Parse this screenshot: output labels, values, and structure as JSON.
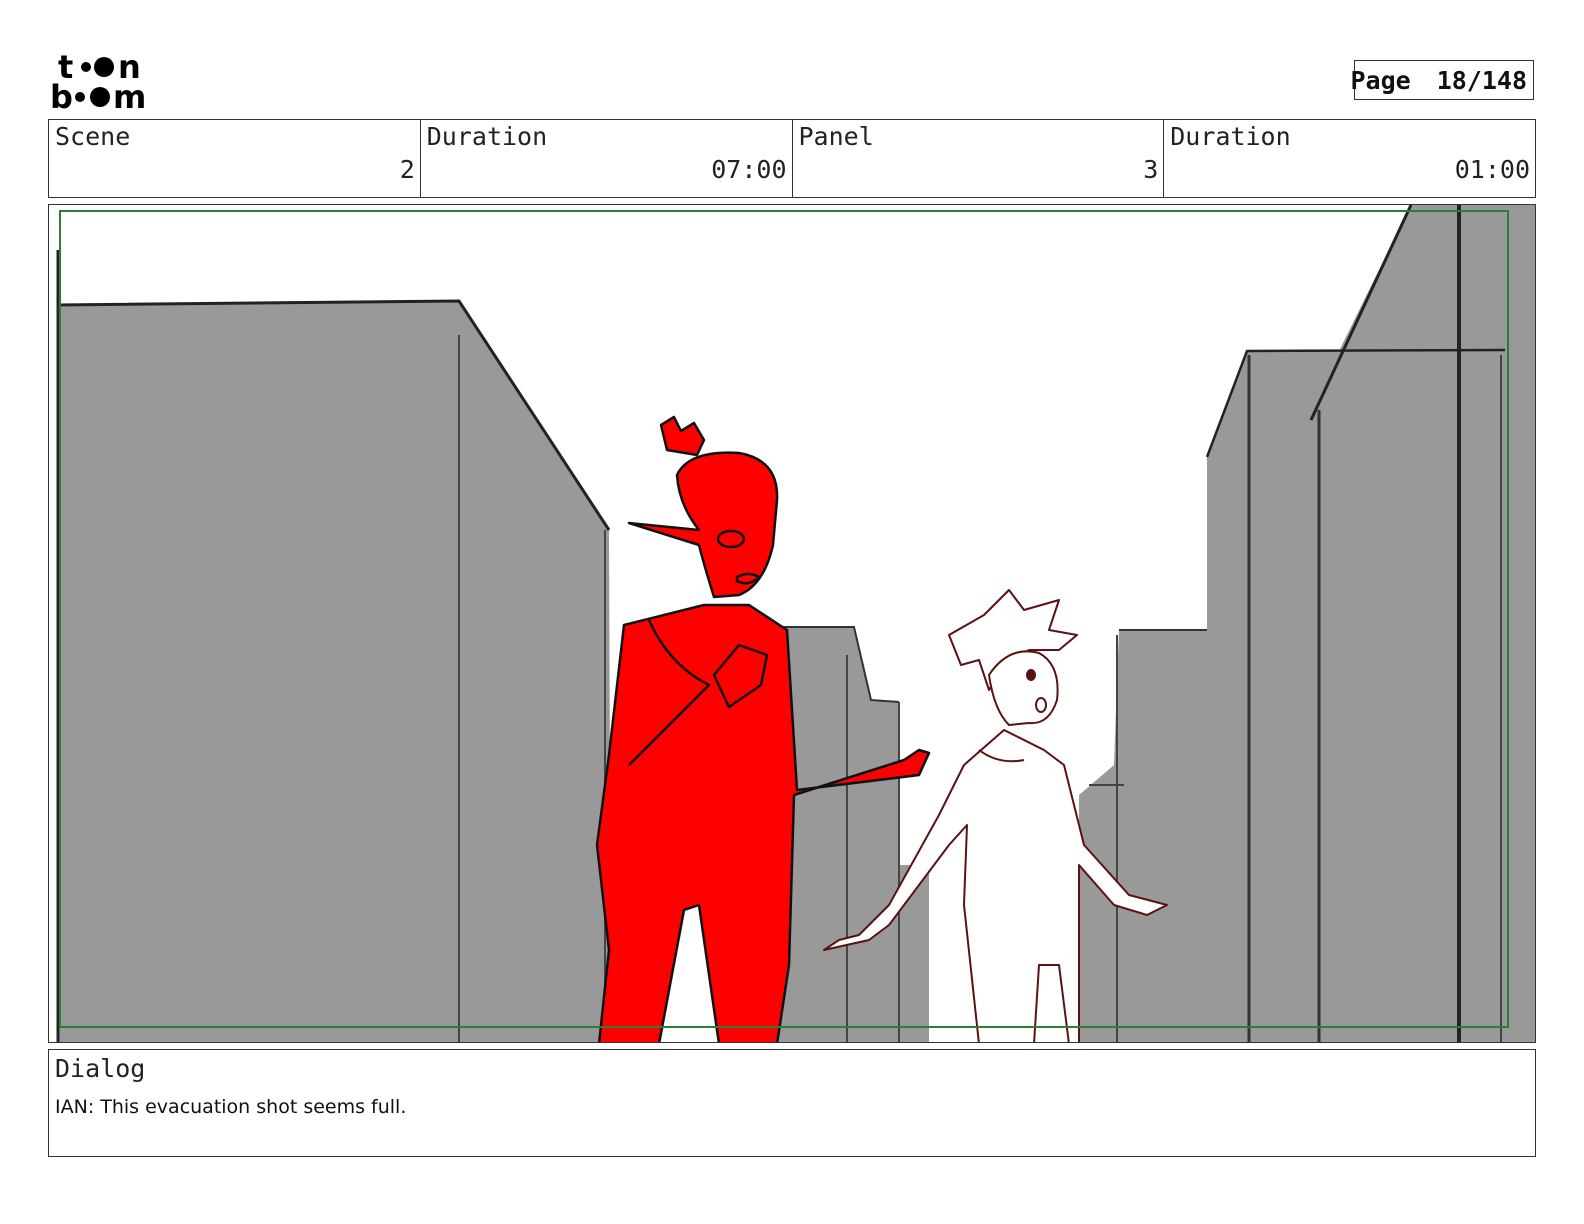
{
  "logo": {
    "line1": "toon",
    "line2": "boom"
  },
  "page": {
    "label": "Page",
    "value": "18/148"
  },
  "header": {
    "scene_label": "Scene",
    "scene_value": "2",
    "scene_duration_label": "Duration",
    "scene_duration_value": "07:00",
    "panel_label": "Panel",
    "panel_value": "3",
    "panel_duration_label": "Duration",
    "panel_duration_value": "01:00"
  },
  "dialog": {
    "label": "Dialog",
    "text": "IAN: This evacuation shot seems full."
  },
  "colors": {
    "building": "#999999",
    "red_character": "#ff0000",
    "outline": "#222222",
    "frame_guide": "#2e7d32"
  }
}
